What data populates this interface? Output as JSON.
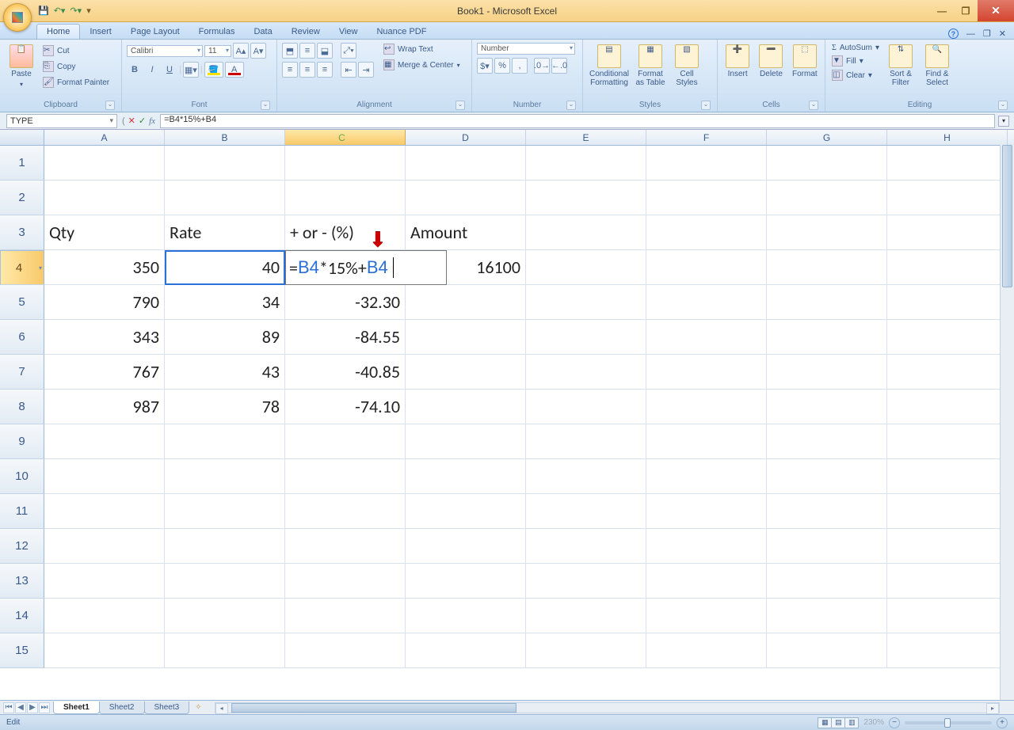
{
  "title": "Book1 - Microsoft Excel",
  "qat": {
    "save": "save-icon",
    "undo": "undo-icon",
    "redo": "redo-icon"
  },
  "tabs": [
    "Home",
    "Insert",
    "Page Layout",
    "Formulas",
    "Data",
    "Review",
    "View",
    "Nuance PDF"
  ],
  "active_tab": "Home",
  "ribbon": {
    "clipboard": {
      "label": "Clipboard",
      "paste": "Paste",
      "cut": "Cut",
      "copy": "Copy",
      "format_painter": "Format Painter"
    },
    "font": {
      "label": "Font",
      "family": "Calibri",
      "size": "11",
      "bold": "B",
      "italic": "I",
      "underline": "U"
    },
    "alignment": {
      "label": "Alignment",
      "wrap": "Wrap Text",
      "merge": "Merge & Center"
    },
    "number": {
      "label": "Number",
      "format": "Number"
    },
    "styles": {
      "label": "Styles",
      "cf": "Conditional Formatting",
      "table": "Format as Table",
      "cell": "Cell Styles"
    },
    "cells": {
      "label": "Cells",
      "insert": "Insert",
      "delete": "Delete",
      "format": "Format"
    },
    "editing": {
      "label": "Editing",
      "autosum": "AutoSum",
      "fill": "Fill",
      "clear": "Clear",
      "sort": "Sort & Filter",
      "find": "Find & Select"
    }
  },
  "name_box": "TYPE",
  "formula": "=B4*15%+B4",
  "columns": [
    "A",
    "B",
    "C",
    "D",
    "E",
    "F",
    "G",
    "H"
  ],
  "active_col_index": 2,
  "active_row": 4,
  "visible_rows": 15,
  "data": {
    "3": {
      "A": "Qty",
      "B": "Rate",
      "C": "+ or - (%)",
      "D": "Amount"
    },
    "4": {
      "A": "350",
      "B": "40",
      "C_formula": "=B4*15%+B4",
      "D": "16100"
    },
    "5": {
      "A": "790",
      "B": "34",
      "C": "-32.30"
    },
    "6": {
      "A": "343",
      "B": "89",
      "C": "-84.55"
    },
    "7": {
      "A": "767",
      "B": "43",
      "C": "-40.85"
    },
    "8": {
      "A": "987",
      "B": "78",
      "C": "-74.10"
    }
  },
  "sheets": [
    "Sheet1",
    "Sheet2",
    "Sheet3"
  ],
  "active_sheet": "Sheet1",
  "status_mode": "Edit",
  "zoom": "230%"
}
